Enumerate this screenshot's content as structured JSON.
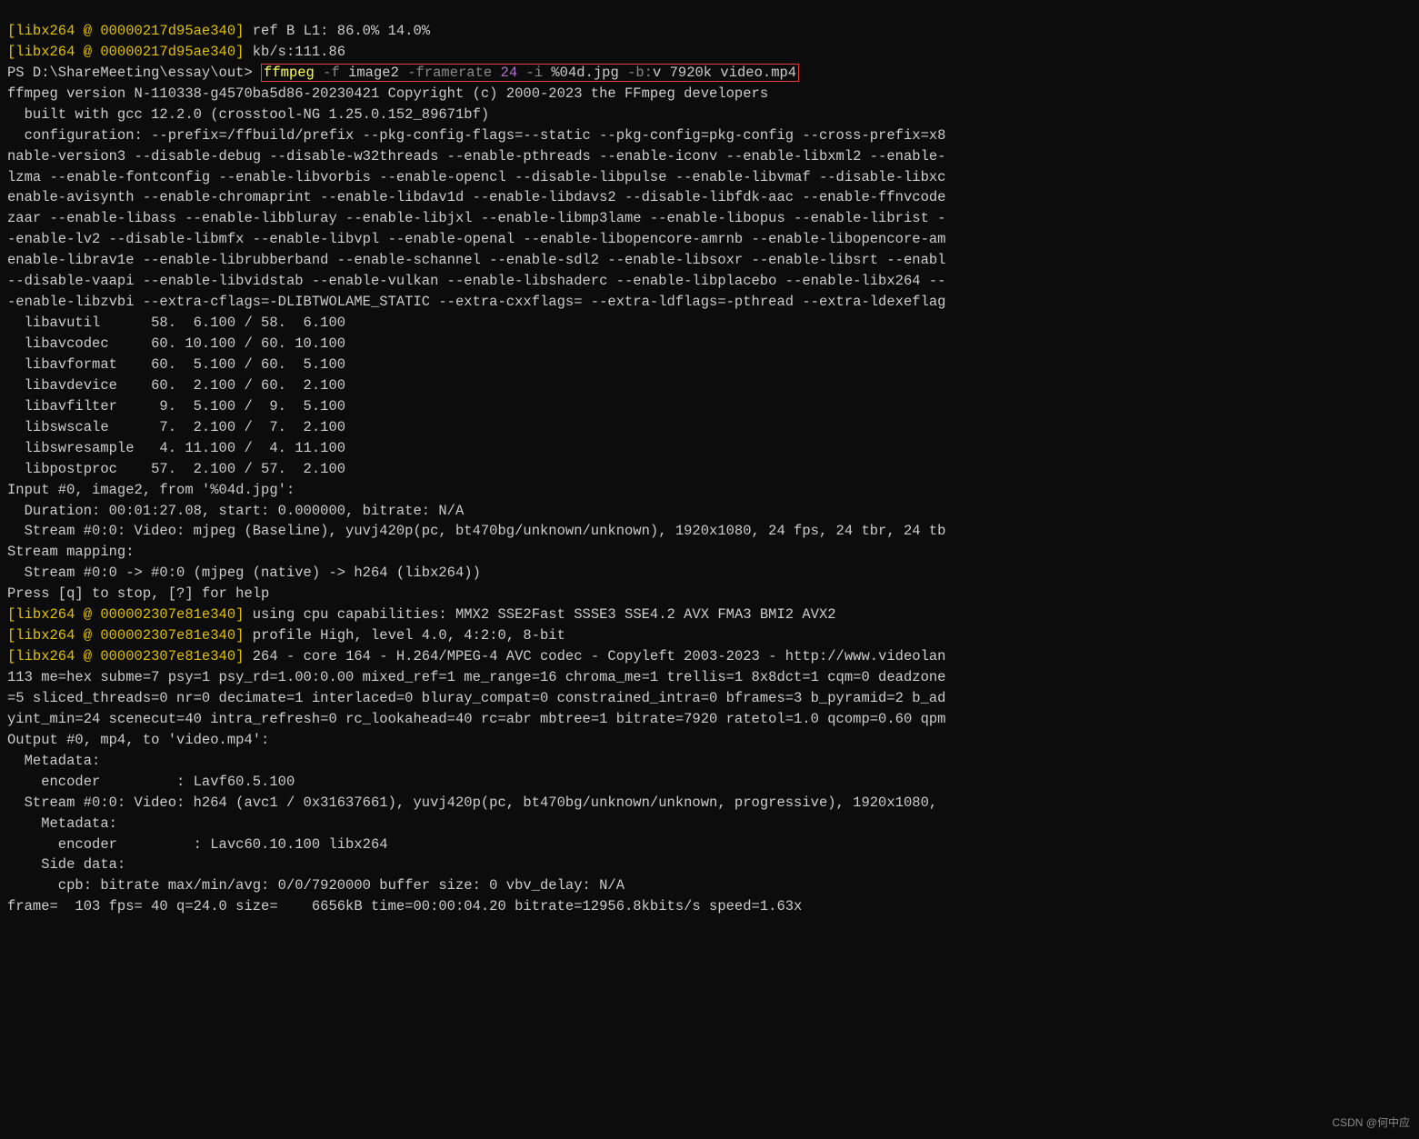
{
  "line1_tag": "[libx264 @ 00000217d95ae340]",
  "line1_rest": " ref B L1: 86.0% 14.0%",
  "line2_tag": "[libx264 @ 00000217d95ae340]",
  "line2_rest": " kb/s:111.86",
  "prompt": "PS D:\\ShareMeeting\\essay\\out> ",
  "cmd_ffmpeg": "ffmpeg",
  "cmd_f": " -f ",
  "cmd_image2": "image2",
  "cmd_framerate": " -framerate ",
  "cmd_24": "24",
  "cmd_i": " -i ",
  "cmd_pattern": "%04d.jpg",
  "cmd_b": " -b:",
  "cmd_bv": "v 7920k video.mp4",
  "body": "ffmpeg version N-110338-g4570ba5d86-20230421 Copyright (c) 2000-2023 the FFmpeg developers\n  built with gcc 12.2.0 (crosstool-NG 1.25.0.152_89671bf)\n  configuration: --prefix=/ffbuild/prefix --pkg-config-flags=--static --pkg-config=pkg-config --cross-prefix=x8\nnable-version3 --disable-debug --disable-w32threads --enable-pthreads --enable-iconv --enable-libxml2 --enable-\nlzma --enable-fontconfig --enable-libvorbis --enable-opencl --disable-libpulse --enable-libvmaf --disable-libxc\nenable-avisynth --enable-chromaprint --enable-libdav1d --enable-libdavs2 --disable-libfdk-aac --enable-ffnvcode\nzaar --enable-libass --enable-libbluray --enable-libjxl --enable-libmp3lame --enable-libopus --enable-librist -\n-enable-lv2 --disable-libmfx --enable-libvpl --enable-openal --enable-libopencore-amrnb --enable-libopencore-am\nenable-librav1e --enable-librubberband --enable-schannel --enable-sdl2 --enable-libsoxr --enable-libsrt --enabl\n--disable-vaapi --enable-libvidstab --enable-vulkan --enable-libshaderc --enable-libplacebo --enable-libx264 --\n-enable-libzvbi --extra-cflags=-DLIBTWOLAME_STATIC --extra-cxxflags= --extra-ldflags=-pthread --extra-ldexeflag\n  libavutil      58.  6.100 / 58.  6.100\n  libavcodec     60. 10.100 / 60. 10.100\n  libavformat    60.  5.100 / 60.  5.100\n  libavdevice    60.  2.100 / 60.  2.100\n  libavfilter     9.  5.100 /  9.  5.100\n  libswscale      7.  2.100 /  7.  2.100\n  libswresample   4. 11.100 /  4. 11.100\n  libpostproc    57.  2.100 / 57.  2.100\nInput #0, image2, from '%04d.jpg':\n  Duration: 00:01:27.08, start: 0.000000, bitrate: N/A\n  Stream #0:0: Video: mjpeg (Baseline), yuvj420p(pc, bt470bg/unknown/unknown), 1920x1080, 24 fps, 24 tbr, 24 tb\nStream mapping:\n  Stream #0:0 -> #0:0 (mjpeg (native) -> h264 (libx264))\nPress [q] to stop, [?] for help",
  "lx1_tag": "[libx264 @ 000002307e81e340]",
  "lx1_rest": " using cpu capabilities: MMX2 SSE2Fast SSSE3 SSE4.2 AVX FMA3 BMI2 AVX2",
  "lx2_tag": "[libx264 @ 000002307e81e340]",
  "lx2_rest": " profile High, level 4.0, 4:2:0, 8-bit",
  "lx3_tag": "[libx264 @ 000002307e81e340]",
  "lx3_rest": " 264 - core 164 - H.264/MPEG-4 AVC codec - Copyleft 2003-2023 - http://www.videolan\n113 me=hex subme=7 psy=1 psy_rd=1.00:0.00 mixed_ref=1 me_range=16 chroma_me=1 trellis=1 8x8dct=1 cqm=0 deadzone\n=5 sliced_threads=0 nr=0 decimate=1 interlaced=0 bluray_compat=0 constrained_intra=0 bframes=3 b_pyramid=2 b_ad\nyint_min=24 scenecut=40 intra_refresh=0 rc_lookahead=40 rc=abr mbtree=1 bitrate=7920 ratetol=1.0 qcomp=0.60 qpm\nOutput #0, mp4, to 'video.mp4':\n  Metadata:\n    encoder         : Lavf60.5.100\n  Stream #0:0: Video: h264 (avc1 / 0x31637661), yuvj420p(pc, bt470bg/unknown/unknown, progressive), 1920x1080,\n    Metadata:\n      encoder         : Lavc60.10.100 libx264\n    Side data:\n      cpb: bitrate max/min/avg: 0/0/7920000 buffer size: 0 vbv_delay: N/A\nframe=  103 fps= 40 q=24.0 size=    6656kB time=00:00:04.20 bitrate=12956.8kbits/s speed=1.63x",
  "watermark": "CSDN @何中应"
}
